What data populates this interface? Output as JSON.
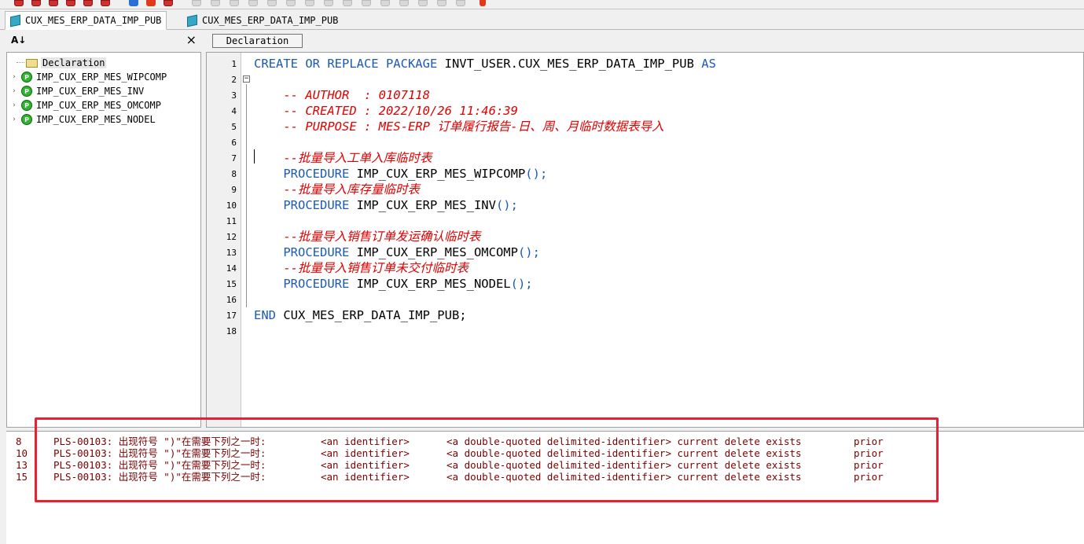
{
  "tabs": [
    {
      "label": "CUX_MES_ERP_DATA_IMP_PUB",
      "icon": "package-spec-icon",
      "active": true
    },
    {
      "label": "CUX_MES_ERP_DATA_IMP_PUB",
      "icon": "package-body-icon",
      "active": false
    }
  ],
  "left_panel": {
    "sort_icon": "sort-alpha-icon",
    "close_label": "×",
    "tree": {
      "root": "Declaration",
      "items": [
        {
          "label": "IMP_CUX_ERP_MES_WIPCOMP",
          "badge": "P"
        },
        {
          "label": "IMP_CUX_ERP_MES_INV",
          "badge": "P"
        },
        {
          "label": "IMP_CUX_ERP_MES_OMCOMP",
          "badge": "P"
        },
        {
          "label": "IMP_CUX_ERP_MES_NODEL",
          "badge": "P"
        }
      ]
    }
  },
  "editor": {
    "section_button": "Declaration",
    "line_numbers": [
      "1",
      "2",
      "3",
      "4",
      "5",
      "6",
      "7",
      "8",
      "9",
      "10",
      "11",
      "12",
      "13",
      "14",
      "15",
      "16",
      "17",
      "18"
    ],
    "lines": [
      [
        {
          "t": "CREATE OR REPLACE PACKAGE ",
          "c": "kw"
        },
        {
          "t": "INVT_USER.CUX_MES_ERP_DATA_IMP_PUB ",
          "c": "id"
        },
        {
          "t": "AS",
          "c": "kw"
        }
      ],
      [],
      [
        {
          "t": "    -- AUTHOR  : 0107118",
          "c": "cm"
        }
      ],
      [
        {
          "t": "    -- CREATED : 2022/10/26 11:46:39",
          "c": "cm"
        }
      ],
      [
        {
          "t": "    -- PURPOSE : MES-ERP 订单履行报告-日、周、月临时数据表导入",
          "c": "cm"
        }
      ],
      [],
      [
        {
          "t": "    --批量导入工单入库临时表",
          "c": "cm"
        }
      ],
      [
        {
          "t": "    PROCEDURE ",
          "c": "kw"
        },
        {
          "t": "IMP_CUX_ERP_MES_WIPCOMP",
          "c": "id"
        },
        {
          "t": "();",
          "c": "pn"
        }
      ],
      [
        {
          "t": "    --批量导入库存量临时表",
          "c": "cm"
        }
      ],
      [
        {
          "t": "    PROCEDURE ",
          "c": "kw"
        },
        {
          "t": "IMP_CUX_ERP_MES_INV",
          "c": "id"
        },
        {
          "t": "();",
          "c": "pn"
        }
      ],
      [],
      [
        {
          "t": "    --批量导入销售订单发运确认临时表",
          "c": "cm"
        }
      ],
      [
        {
          "t": "    PROCEDURE ",
          "c": "kw"
        },
        {
          "t": "IMP_CUX_ERP_MES_OMCOMP",
          "c": "id"
        },
        {
          "t": "();",
          "c": "pn"
        }
      ],
      [
        {
          "t": "    --批量导入销售订单未交付临时表",
          "c": "cm"
        }
      ],
      [
        {
          "t": "    PROCEDURE ",
          "c": "kw"
        },
        {
          "t": "IMP_CUX_ERP_MES_NODEL",
          "c": "id"
        },
        {
          "t": "();",
          "c": "pn"
        }
      ],
      [],
      [
        {
          "t": "END ",
          "c": "kw"
        },
        {
          "t": "CUX_MES_ERP_DATA_IMP_PUB;",
          "c": "id"
        }
      ],
      []
    ]
  },
  "messages": [
    {
      "line": "8",
      "code": "PLS-00103: 出现符号 \")\"在需要下列之一时:",
      "ids": "<an identifier>",
      "rest": "<a double-quoted delimited-identifier> current delete exists",
      "prior": "prior"
    },
    {
      "line": "10",
      "code": "PLS-00103: 出现符号 \")\"在需要下列之一时:",
      "ids": "<an identifier>",
      "rest": "<a double-quoted delimited-identifier> current delete exists",
      "prior": "prior"
    },
    {
      "line": "13",
      "code": "PLS-00103: 出现符号 \")\"在需要下列之一时:",
      "ids": "<an identifier>",
      "rest": "<a double-quoted delimited-identifier> current delete exists",
      "prior": "prior"
    },
    {
      "line": "15",
      "code": "PLS-00103: 出现符号 \")\"在需要下列之一时:",
      "ids": "<an identifier>",
      "rest": "<a double-quoted delimited-identifier> current delete exists",
      "prior": "prior"
    }
  ],
  "colors": {
    "keyword": "#1c5ab3",
    "comment": "#e00000",
    "error_text": "#7a0000",
    "highlight_box": "#e82033"
  }
}
